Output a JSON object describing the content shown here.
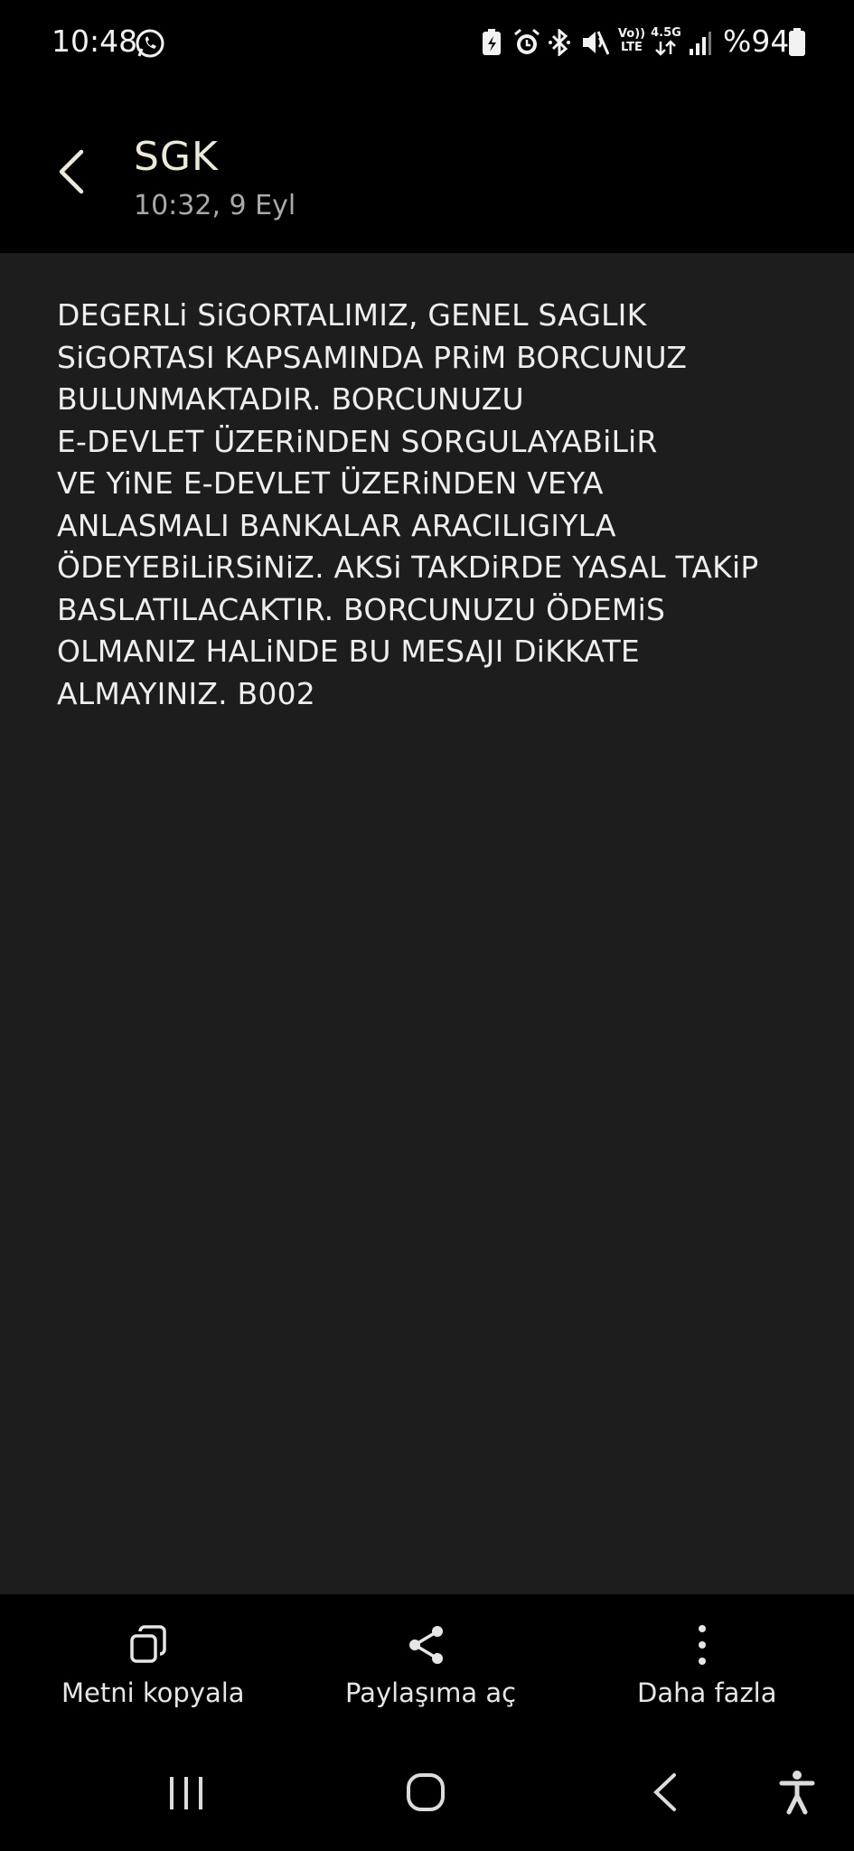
{
  "status_bar": {
    "time": "10:48",
    "battery": "%94",
    "icons": [
      "whatsapp-icon",
      "battery-saver-icon",
      "alarm-icon",
      "bluetooth-icon",
      "mute-icon",
      "volte-icon",
      "4.5g-data-icon",
      "signal-icon",
      "battery-icon"
    ],
    "volte_label": "Vo)) LTE",
    "network_label": "4.5G"
  },
  "header": {
    "sender": "SGK",
    "timestamp": "10:32, 9 Eyl"
  },
  "message": {
    "body": "DEGERLi SiGORTALIMIZ, GENEL SAGLIK\nSiGORTASI KAPSAMINDA PRiM BORCUNUZ\nBULUNMAKTADIR. BORCUNUZU\nE-DEVLET ÜZERiNDEN SORGULAYABiLiR\nVE YiNE E-DEVLET ÜZERiNDEN VEYA\nANLASMALI BANKALAR ARACILIGIYLA\nÖDEYEBiLiRSiNiZ. AKSi TAKDiRDE YASAL TAKiP\nBASLATILACAKTIR. BORCUNUZU ÖDEMiS\nOLMANIZ HALiNDE BU MESAJI DiKKATE\nALMAYINIZ. B002"
  },
  "actions": {
    "copy_label": "Metni kopyala",
    "share_label": "Paylaşıma aç",
    "more_label": "Daha fazla"
  },
  "colors": {
    "background": "#000000",
    "content_bg": "#1d1d1d",
    "sender_text": "#ece9d8",
    "body_text": "#eeeeee"
  }
}
